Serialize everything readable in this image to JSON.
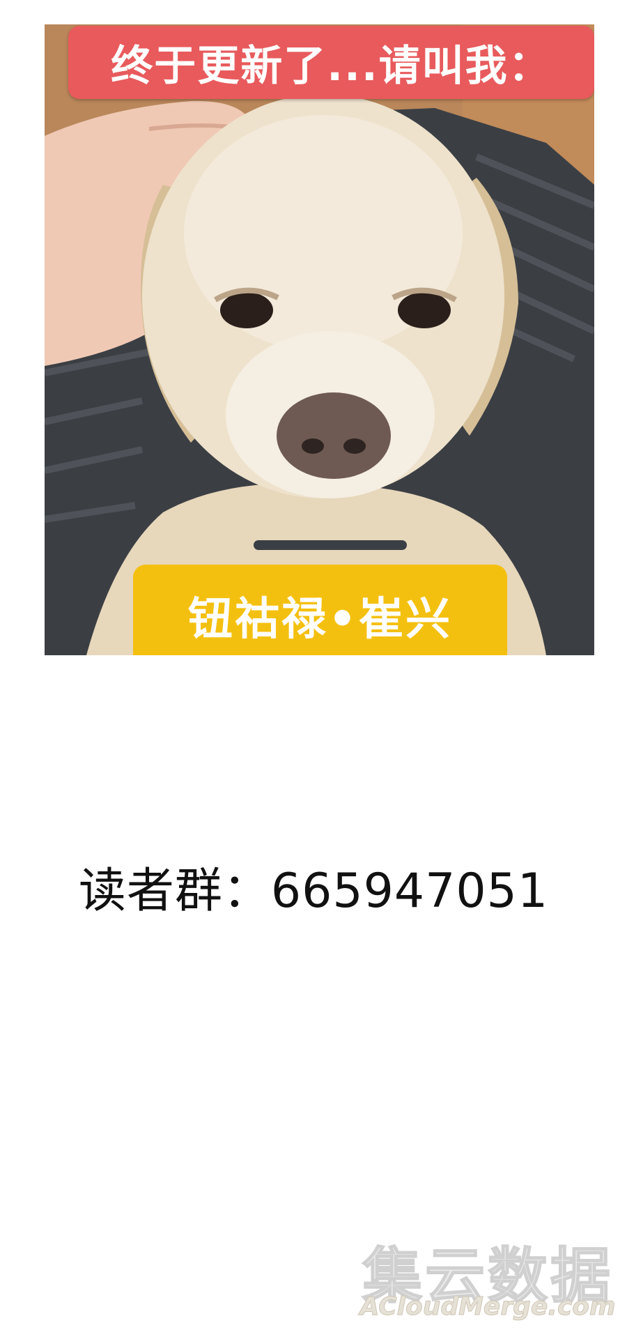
{
  "meme": {
    "top_caption": "终于更新了...请叫我：",
    "bottom_caption": "钮祜禄•崔兴",
    "top_caption_color": "#e85a5c",
    "bottom_caption_color": "#f4c010",
    "subject": "golden-retriever-dog-photo"
  },
  "reader_group": {
    "text": "读者群：665947051"
  },
  "watermark": {
    "chinese": "集云数据",
    "english": "ACloudMerge.com"
  }
}
